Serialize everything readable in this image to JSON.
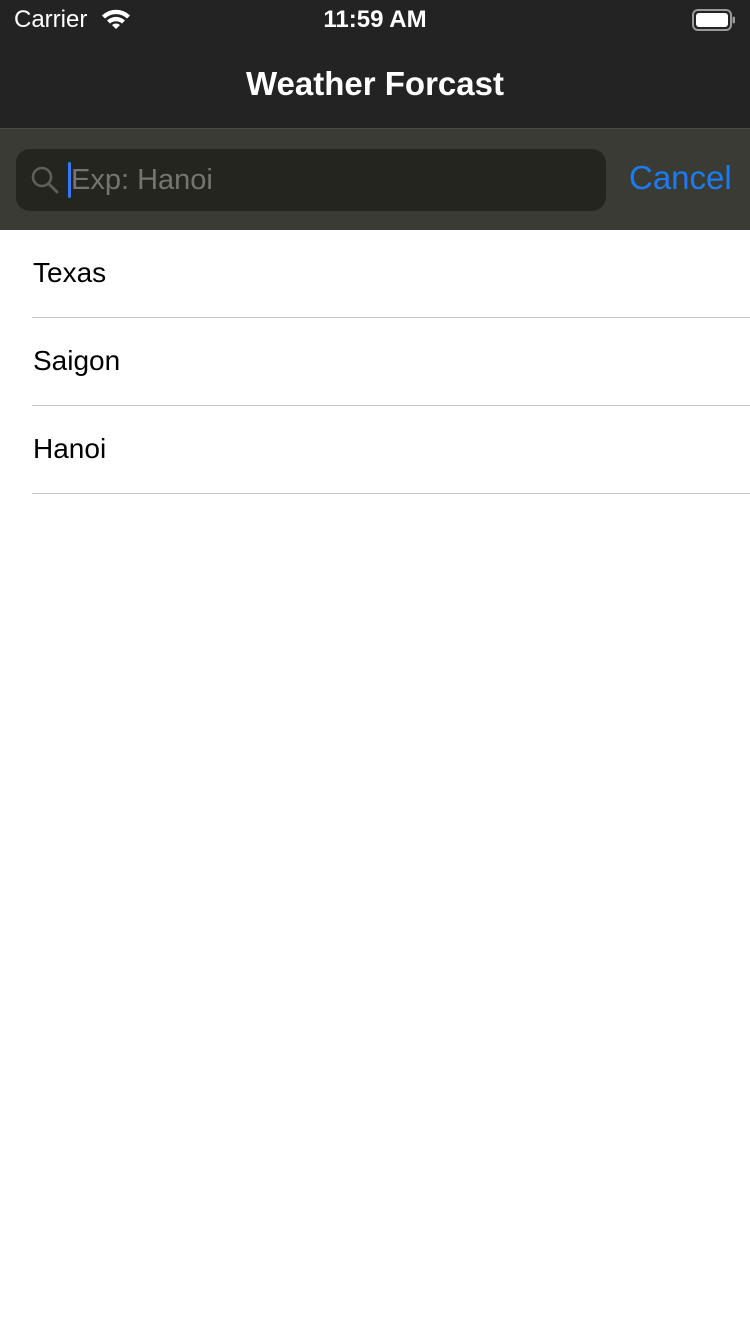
{
  "status_bar": {
    "carrier": "Carrier",
    "time": "11:59 AM",
    "wifi_icon": "wifi-icon",
    "battery_icon": "battery-icon"
  },
  "nav": {
    "title": "Weather Forcast"
  },
  "search": {
    "placeholder": "Exp: Hanoi",
    "value": "",
    "icon": "search-icon",
    "cancel_label": "Cancel"
  },
  "cities": [
    {
      "label": "Texas"
    },
    {
      "label": "Saigon"
    },
    {
      "label": "Hanoi"
    }
  ],
  "colors": {
    "nav_background": "#232323",
    "search_background": "#3b3b35",
    "field_background": "#25251f",
    "accent": "#1a7cf0",
    "cursor": "#3478f6"
  }
}
